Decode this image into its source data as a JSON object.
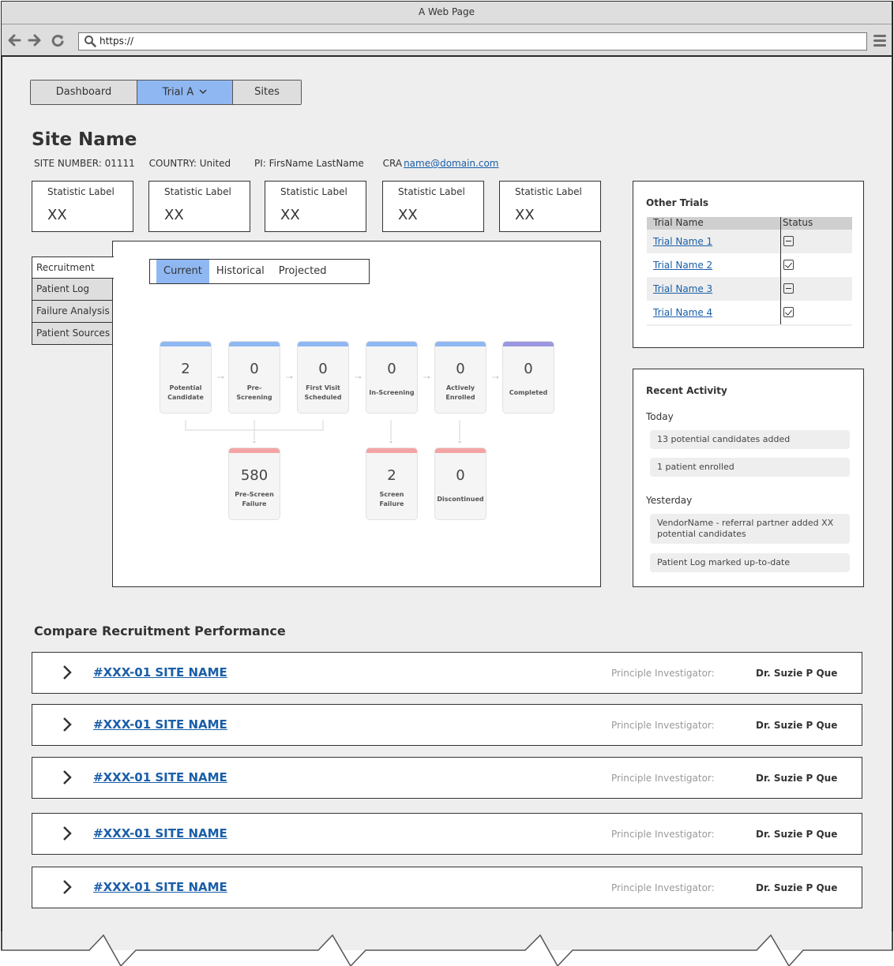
{
  "browser": {
    "title": "A Web Page",
    "url": "https://",
    "icons": [
      "back-icon",
      "forward-icon",
      "reload-icon",
      "search-icon",
      "menu-icon"
    ]
  },
  "nav_tabs": [
    {
      "label": "Dashboard",
      "active": false
    },
    {
      "label": "Trial A",
      "active": true,
      "dropdown": true
    },
    {
      "label": "Sites",
      "active": false
    }
  ],
  "site": {
    "title": "Site Name",
    "site_number": "SITE NUMBER: 01111",
    "country": "COUNTRY: United",
    "pi": "PI: FirsName LastName",
    "cra_label": "CRA",
    "cra_email": "name@domain.com"
  },
  "stats": [
    {
      "label": "Statistic Label",
      "value": "XX"
    },
    {
      "label": "Statistic Label",
      "value": "XX"
    },
    {
      "label": "Statistic Label",
      "value": "XX"
    },
    {
      "label": "Statistic Label",
      "value": "XX"
    },
    {
      "label": "Statistic Label",
      "value": "XX"
    }
  ],
  "side_tabs": [
    {
      "label": "Recruitment",
      "active": true
    },
    {
      "label": "Patient Log",
      "active": false
    },
    {
      "label": "Failure Analysis",
      "active": false
    },
    {
      "label": "Patient Sources",
      "active": false
    }
  ],
  "segments": [
    {
      "label": "Current",
      "active": true
    },
    {
      "label": "Historical",
      "active": false
    },
    {
      "label": "Projected",
      "active": false
    }
  ],
  "funnel": {
    "colors": {
      "stage": "#8fb8f2",
      "complete": "#9b97e0",
      "failure": "#f4a4a4"
    },
    "stages": [
      {
        "value": "2",
        "label": "Potential Candidate"
      },
      {
        "value": "0",
        "label": "Pre-Screening"
      },
      {
        "value": "0",
        "label": "First Visit Scheduled"
      },
      {
        "value": "0",
        "label": "In-Screening"
      },
      {
        "value": "0",
        "label": "Actively Enrolled"
      },
      {
        "value": "0",
        "label": "Completed"
      }
    ],
    "failures": [
      {
        "value": "580",
        "label": "Pre-Screen Failure"
      },
      {
        "value": "2",
        "label": "Screen Failure"
      },
      {
        "value": "0",
        "label": "Discontinued"
      }
    ]
  },
  "other_trials": {
    "title": "Other Trials",
    "columns": [
      "Trial Name",
      "Status"
    ],
    "rows": [
      {
        "name": "Trial Name 1",
        "status": "partial"
      },
      {
        "name": "Trial Name 2",
        "status": "checked"
      },
      {
        "name": "Trial Name 3",
        "status": "partial"
      },
      {
        "name": "Trial Name 4",
        "status": "checked"
      }
    ]
  },
  "recent_activity": {
    "title": "Recent Activity",
    "groups": [
      {
        "day": "Today",
        "items": [
          "13 potential candidates added",
          "1 patient enrolled"
        ]
      },
      {
        "day": "Yesterday",
        "items": [
          "VendorName - referral partner added XX potential candidates",
          "Patient Log marked up-to-date"
        ]
      }
    ]
  },
  "compare": {
    "title": "Compare Recruitment Performance",
    "rows": [
      {
        "site": "#XXX-01 SITE NAME",
        "pi_label": "Principle Investigator:",
        "pi_name": "Dr. Suzie P Que"
      },
      {
        "site": "#XXX-01 SITE NAME",
        "pi_label": "Principle Investigator:",
        "pi_name": "Dr. Suzie P Que"
      },
      {
        "site": "#XXX-01 SITE NAME",
        "pi_label": "Principle Investigator:",
        "pi_name": "Dr. Suzie P Que"
      },
      {
        "site": "#XXX-01 SITE NAME",
        "pi_label": "Principle Investigator:",
        "pi_name": "Dr. Suzie P Que"
      },
      {
        "site": "#XXX-01 SITE NAME",
        "pi_label": "Principle Investigator:",
        "pi_name": "Dr. Suzie P Que"
      }
    ]
  }
}
